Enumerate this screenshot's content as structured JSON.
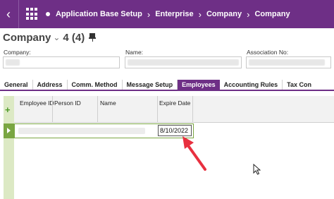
{
  "topbar": {
    "back_icon": "chevron-left-icon",
    "breadcrumb": [
      "Application Base Setup",
      "Enterprise",
      "Company",
      "Company"
    ]
  },
  "page": {
    "title": "Company",
    "count": "4 (4)"
  },
  "fields": {
    "company_label": "Company:",
    "name_label": "Name:",
    "association_label": "Association No:"
  },
  "tabs": [
    {
      "label": "General"
    },
    {
      "label": "Address"
    },
    {
      "label": "Comm. Method"
    },
    {
      "label": "Message Setup"
    },
    {
      "label": "Employees",
      "active": true
    },
    {
      "label": "Accounting Rules"
    },
    {
      "label": "Tax Con"
    }
  ],
  "grid": {
    "columns": [
      "Employee ID",
      "Person ID",
      "Name",
      "Expire Date"
    ],
    "rows": [
      {
        "expire_date": "8/10/2022"
      }
    ]
  },
  "colors": {
    "accent": "#6e2f86",
    "row_select": "#7aa642",
    "annotation_arrow": "#e8303f"
  }
}
